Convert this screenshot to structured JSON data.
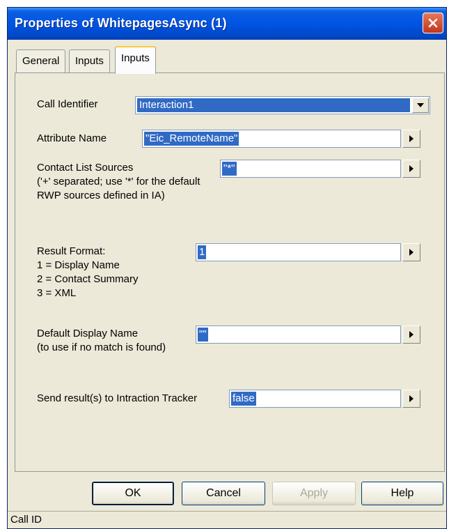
{
  "window": {
    "title": "Properties of WhitepagesAsync (1)",
    "close_icon": "close-icon",
    "accent_color": "#0054e3",
    "close_color": "#c2351a"
  },
  "tabs": [
    {
      "label": "General",
      "active": false
    },
    {
      "label": "Inputs",
      "active": false
    },
    {
      "label": "Inputs",
      "active": true
    }
  ],
  "form": {
    "call_identifier": {
      "label": "Call Identifier",
      "value": "Interaction1",
      "icon": "dropdown-arrow-icon"
    },
    "attribute_name": {
      "label": "Attribute Name",
      "value": "\"Eic_RemoteName\"",
      "icon": "play-arrow-icon"
    },
    "contact_list_sources": {
      "label_lines": [
        "Contact List Sources",
        "('+' separated; use '*' for the default",
        "RWP sources defined in IA)"
      ],
      "value": "\"*\"",
      "icon": "play-arrow-icon"
    },
    "result_format": {
      "label_lines": [
        "Result Format:",
        "1 = Display Name",
        "2 = Contact Summary",
        "3 = XML"
      ],
      "value": "1",
      "icon": "play-arrow-icon"
    },
    "default_display_name": {
      "label_lines": [
        "Default Display Name",
        "(to use if no match is found)"
      ],
      "value": "\"\"",
      "icon": "play-arrow-icon"
    },
    "send_results": {
      "label": "Send result(s) to Intraction Tracker",
      "value": "false",
      "icon": "play-arrow-icon"
    }
  },
  "buttons": {
    "ok": "OK",
    "cancel": "Cancel",
    "apply": "Apply",
    "help": "Help"
  },
  "status_bar": {
    "text": "Call ID"
  },
  "selection_color": "#316ac5"
}
